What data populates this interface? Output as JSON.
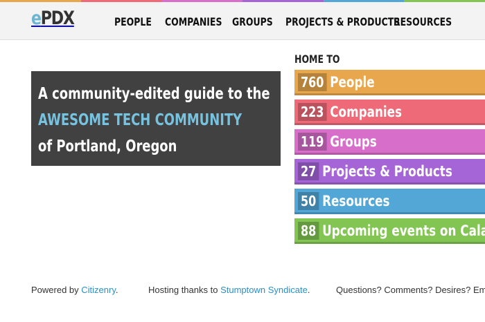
{
  "colors": {
    "orange": "#e8a74c",
    "red": "#ee6a78",
    "pink": "#d76ec9",
    "purple": "#a665d7",
    "blue": "#52a7d7",
    "green": "#82c553",
    "accent": "#77c2de"
  },
  "header": {
    "logo_e": "e",
    "logo_pdx": "PDX",
    "nav": [
      {
        "label": "PEOPLE"
      },
      {
        "label": "COMPANIES"
      },
      {
        "label": "GROUPS"
      },
      {
        "label": "PROJECTS & PRODUCTS"
      },
      {
        "label": "RESOURCES"
      }
    ]
  },
  "hero": {
    "line1": "A community-edited guide to the",
    "line2": "AWESOME TECH COMMUNITY",
    "line3": "of Portland, Oregon"
  },
  "home": {
    "title": "HOME TO",
    "items": [
      {
        "count": "760",
        "label": "People",
        "color": "#e8a74c"
      },
      {
        "count": "223",
        "label": "Companies",
        "color": "#ee6a78"
      },
      {
        "count": "119",
        "label": "Groups",
        "color": "#d76ec9"
      },
      {
        "count": "27",
        "label": "Projects & Products",
        "color": "#a665d7"
      },
      {
        "count": "50",
        "label": "Resources",
        "color": "#52a7d7"
      },
      {
        "count": "88",
        "label": "Upcoming events on Calagator",
        "color": "#82c553"
      }
    ]
  },
  "footer": {
    "powered_prefix": "Powered by ",
    "powered_link": "Citizenry",
    "powered_suffix": ".",
    "hosting_prefix": "Hosting thanks to ",
    "hosting_link": "Stumptown Syndicate",
    "hosting_suffix": ".",
    "questions": "Questions? Comments? Desires? Email"
  }
}
